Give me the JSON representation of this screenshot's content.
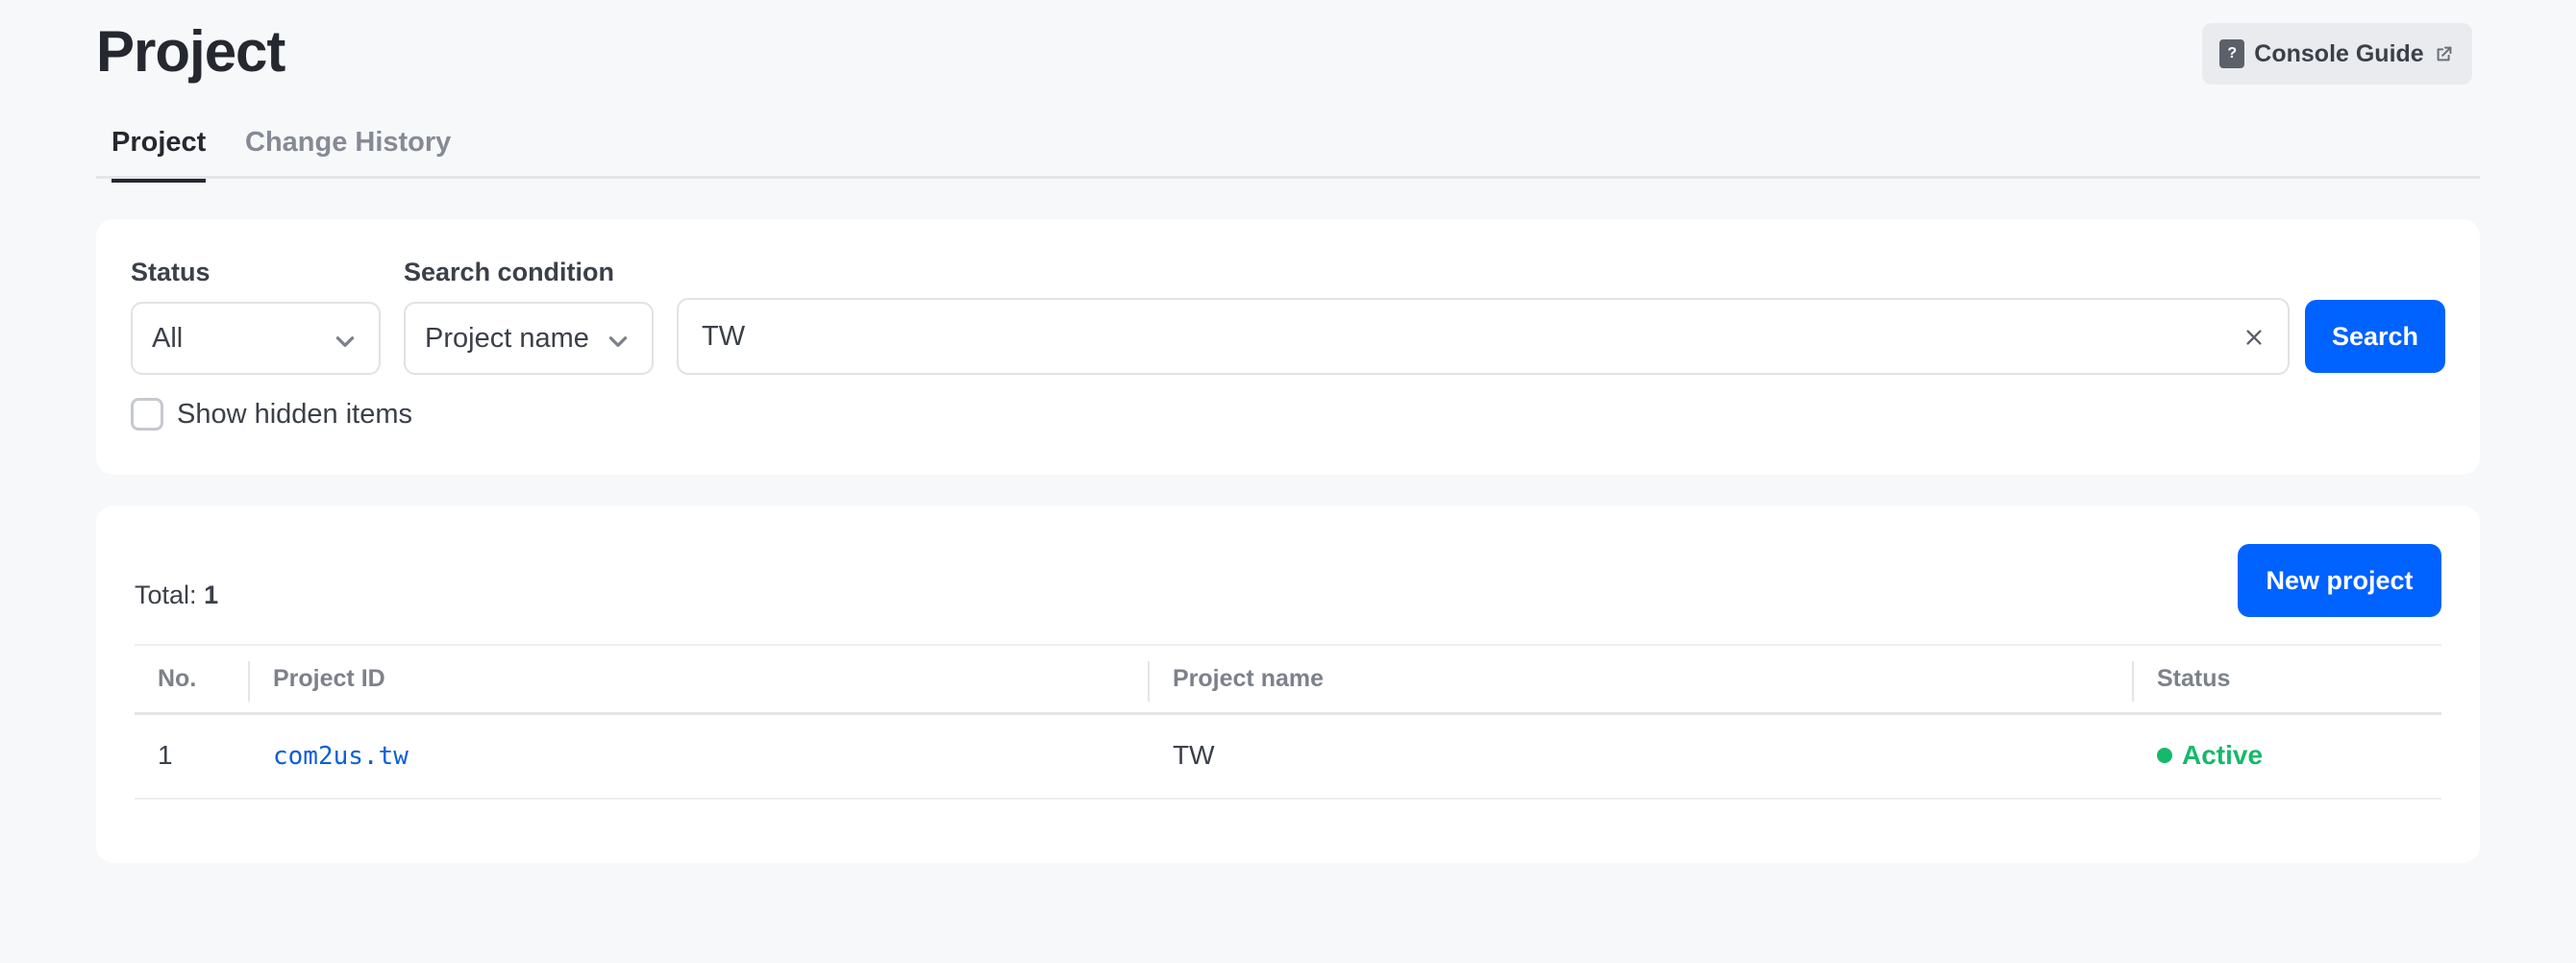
{
  "page": {
    "title": "Project"
  },
  "header": {
    "guide_label": "Console Guide",
    "guide_icon": "question-doc-icon"
  },
  "tabs": [
    {
      "label": "Project",
      "active": true
    },
    {
      "label": "Change History",
      "active": false
    }
  ],
  "filters": {
    "status_label": "Status",
    "status_value": "All",
    "condition_label": "Search condition",
    "condition_value": "Project name",
    "search_value": "TW",
    "search_button": "Search",
    "show_hidden_label": "Show hidden items",
    "show_hidden_checked": false
  },
  "list": {
    "total_label": "Total:",
    "total_count": "1",
    "new_button": "New project",
    "columns": [
      "No.",
      "Project ID",
      "Project name",
      "Status"
    ],
    "rows": [
      {
        "no": "1",
        "project_id": "com2us.tw",
        "project_name": "TW",
        "status": "Active"
      }
    ]
  },
  "colors": {
    "primary": "#0062ff",
    "active_status": "#15b96b",
    "link": "#0a5fd8",
    "background": "#f7f8fa"
  }
}
